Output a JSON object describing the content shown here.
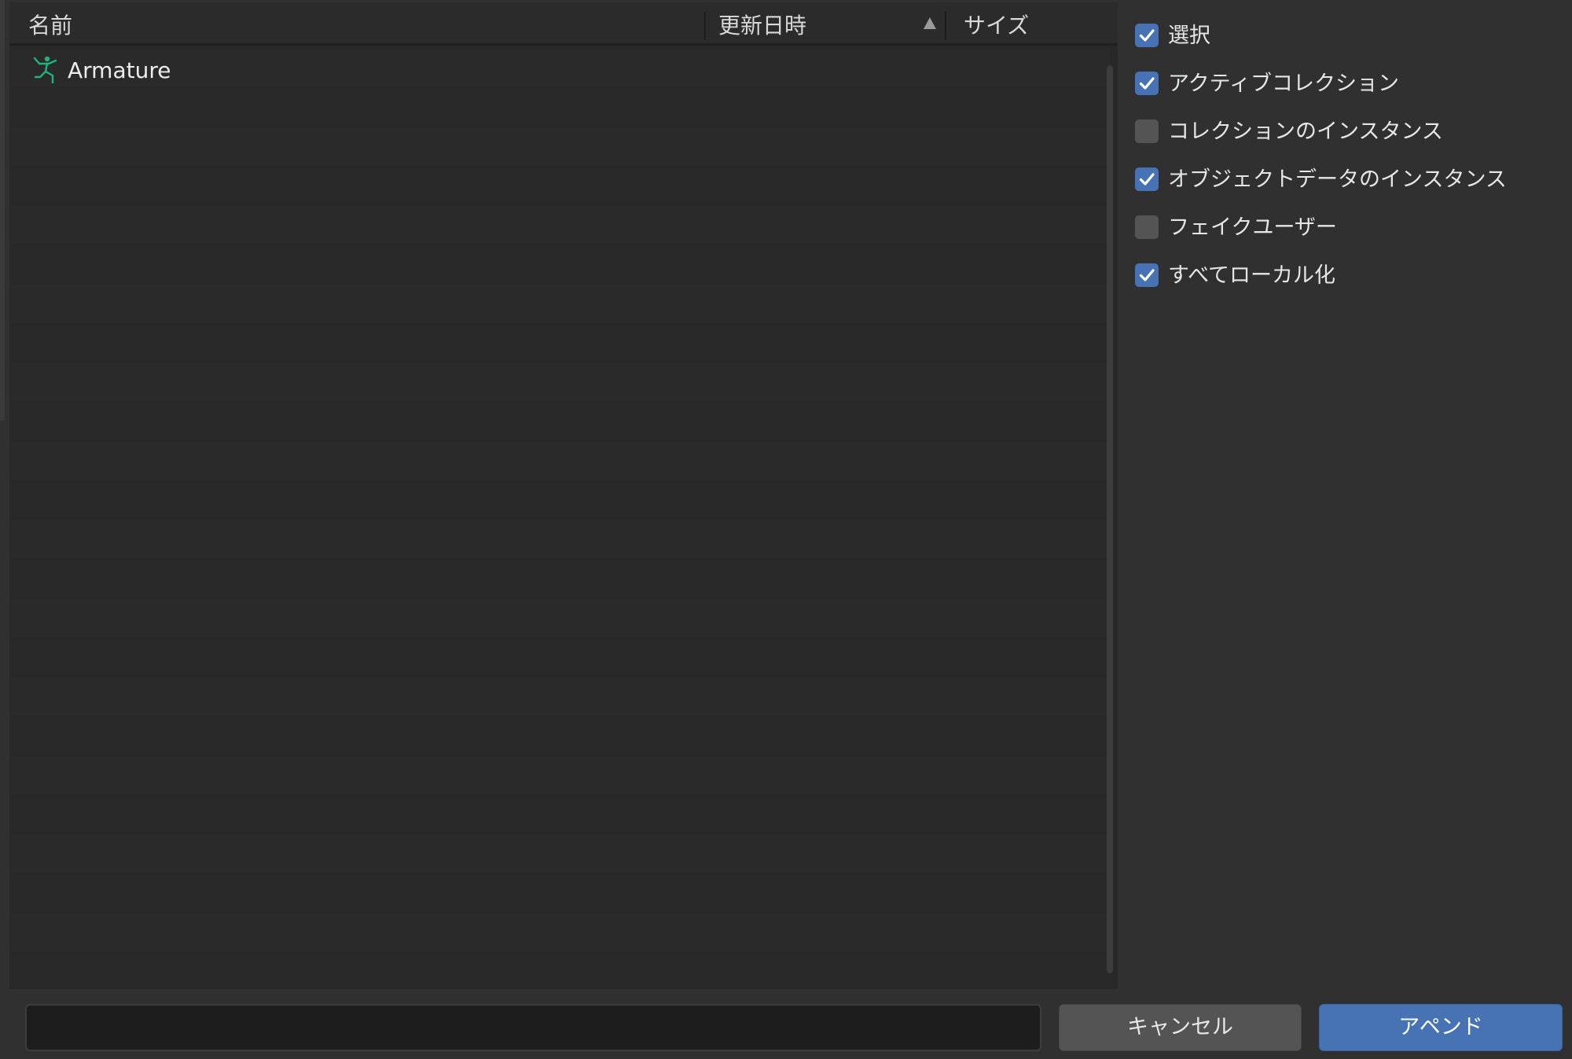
{
  "file_list": {
    "columns": {
      "name": "名前",
      "modified": "更新日時",
      "size": "サイズ"
    },
    "sort_indicator": "ascending",
    "items": [
      {
        "name": "Armature",
        "icon": "armature-icon",
        "icon_color": "#1fb57a"
      }
    ]
  },
  "options": [
    {
      "label": "選択",
      "checked": true
    },
    {
      "label": "アクティブコレクション",
      "checked": true
    },
    {
      "label": "コレクションのインスタンス",
      "checked": false
    },
    {
      "label": "オブジェクトデータのインスタンス",
      "checked": true
    },
    {
      "label": "フェイクユーザー",
      "checked": false
    },
    {
      "label": "すべてローカル化",
      "checked": true
    }
  ],
  "bottom_bar": {
    "filename_value": "",
    "cancel_label": "キャンセル",
    "append_label": "アペンド"
  },
  "colors": {
    "accent": "#4772b3",
    "checkbox_off": "#545454",
    "background": "#303030"
  }
}
